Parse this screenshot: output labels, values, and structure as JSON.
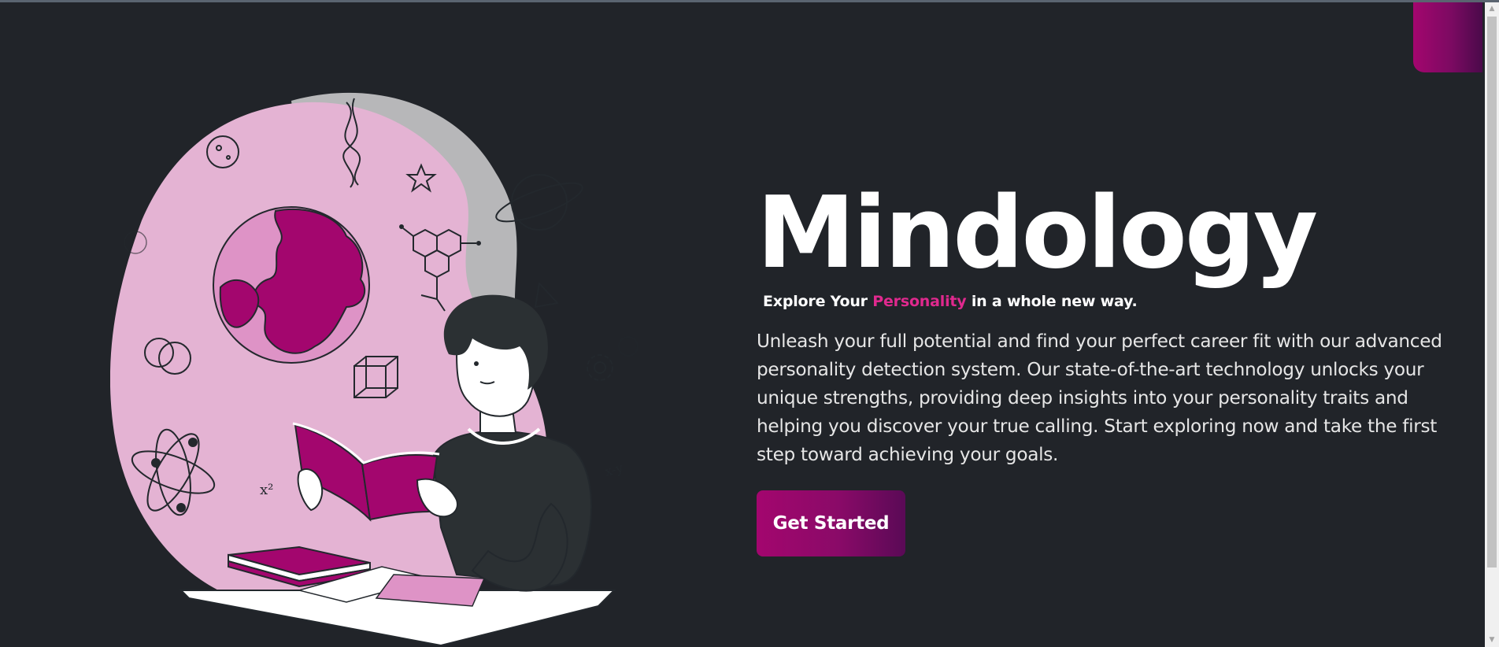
{
  "hero": {
    "title": "Mindology",
    "tagline_prefix": "Explore Your ",
    "tagline_accent": "Personality",
    "tagline_suffix": " in a whole new way.",
    "description": "Unleash your full potential and find your perfect career fit with our advanced personality detection system. Our state-of-the-art technology unlocks your unique strengths, providing deep insights into your personality traits and helping you discover your true calling. Start exploring now and take the first step toward achieving your goals.",
    "cta_label": "Get Started"
  },
  "illustration": {
    "formula_x2": "x²",
    "formula_xy": "x-y"
  },
  "colors": {
    "background": "#212429",
    "accent_pink": "#e0298e",
    "brand_magenta": "#a3066e",
    "brand_purple": "#5a0a56",
    "blob_pink": "#e4b3d3",
    "blob_gray": "#b7b7b9"
  },
  "icons": [
    "dna-icon",
    "star-icon",
    "planet-icon",
    "molecule-icon",
    "atom-icon",
    "cube-icon",
    "gear-icon",
    "globe-icon",
    "triangle-icon"
  ]
}
